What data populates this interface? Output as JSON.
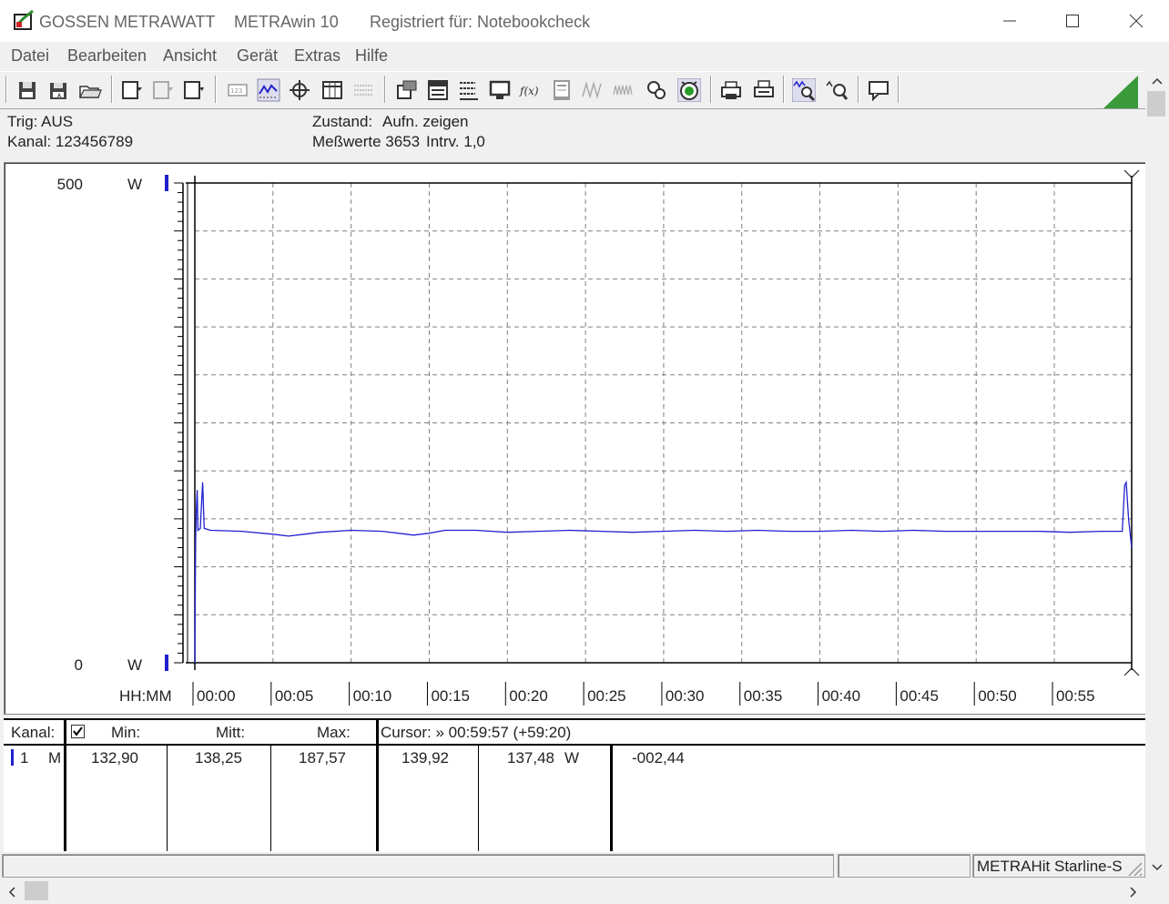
{
  "window": {
    "brand": "GOSSEN METRAWATT",
    "app_name": "METRAwin 10",
    "registration": "Registriert für: Notebookcheck"
  },
  "menu": [
    "Datei",
    "Bearbeiten",
    "Ansicht",
    "Gerät",
    "Extras",
    "Hilfe"
  ],
  "info": {
    "trig": "Trig: AUS",
    "kanal": "Kanal: 123456789",
    "zustand_label": "Zustand:",
    "zustand_value": "Aufn. zeigen",
    "messwerte": "Meßwerte 3653",
    "interval": "Intrv. 1,0"
  },
  "chart_data": {
    "type": "line",
    "y_top_label": "500",
    "y_bottom_label": "0",
    "y_unit": "W",
    "x_axis_label": "HH:MM",
    "x_ticks": [
      "00:00",
      "00:05",
      "00:10",
      "00:15",
      "00:20",
      "00:25",
      "00:30",
      "00:35",
      "00:40",
      "00:45",
      "00:50",
      "00:55"
    ],
    "ylim": [
      0,
      500
    ],
    "xlim_minutes": [
      0,
      59.95
    ],
    "series": [
      {
        "color": "#2020d0",
        "points": [
          [
            0,
            0
          ],
          [
            0.05,
            130
          ],
          [
            0.1,
            160
          ],
          [
            0.15,
            180
          ],
          [
            0.2,
            138
          ],
          [
            0.35,
            140
          ],
          [
            0.5,
            188
          ],
          [
            0.6,
            140
          ],
          [
            1,
            138
          ],
          [
            3,
            137
          ],
          [
            5,
            134
          ],
          [
            6,
            132
          ],
          [
            7,
            134
          ],
          [
            8,
            136
          ],
          [
            10,
            138
          ],
          [
            12,
            137
          ],
          [
            13,
            135
          ],
          [
            14,
            133
          ],
          [
            15,
            135
          ],
          [
            16,
            138
          ],
          [
            18,
            138
          ],
          [
            20,
            136
          ],
          [
            22,
            137
          ],
          [
            24,
            138
          ],
          [
            26,
            137
          ],
          [
            28,
            136
          ],
          [
            30,
            137
          ],
          [
            32,
            138
          ],
          [
            34,
            137
          ],
          [
            36,
            138
          ],
          [
            38,
            137
          ],
          [
            40,
            137
          ],
          [
            42,
            138
          ],
          [
            44,
            137
          ],
          [
            46,
            138
          ],
          [
            48,
            137
          ],
          [
            50,
            137
          ],
          [
            52,
            137
          ],
          [
            54,
            137
          ],
          [
            56,
            136
          ],
          [
            58,
            137
          ],
          [
            59.35,
            137
          ],
          [
            59.5,
            185
          ],
          [
            59.6,
            188
          ],
          [
            59.75,
            150
          ],
          [
            59.95,
            120
          ]
        ]
      }
    ],
    "grid": true
  },
  "table": {
    "headers": {
      "kanal": "Kanal:",
      "min": "Min:",
      "mitt": "Mitt:",
      "max": "Max:",
      "cursor": "Cursor: » 00:59:57 (+59:20)"
    },
    "row": {
      "channel": "1",
      "mode": "M",
      "min": "132,90",
      "mitt": "138,25",
      "max": "187,57",
      "cursor_val": "139,92",
      "cursor_val2": "137,48",
      "unit": "W",
      "delta": "-002,44"
    }
  },
  "status": {
    "device": "METRAHit Starline-S"
  },
  "colors": {
    "trace": "#2020d0",
    "grid": "#808080",
    "accent_green": "#3a9a3a"
  }
}
